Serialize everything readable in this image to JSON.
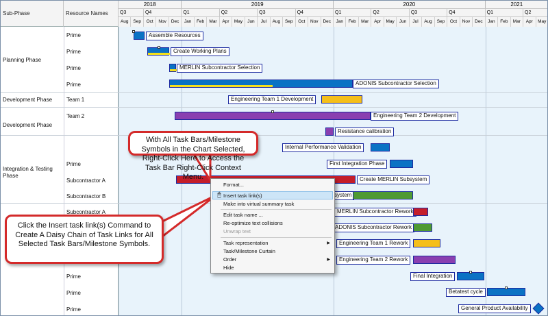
{
  "header": {
    "subphase": "Sub-Phase",
    "resource": "Resource Names",
    "years": [
      "2018",
      "2019",
      "2020",
      "2021"
    ],
    "quarters": [
      "Q3",
      "Q4",
      "Q1",
      "Q2",
      "Q3",
      "Q4",
      "Q1",
      "Q2",
      "Q3",
      "Q4",
      "Q1",
      "Q2"
    ],
    "months": [
      "Aug",
      "Sep",
      "Oct",
      "Nov",
      "Dec",
      "Jan",
      "Feb",
      "Mar",
      "Apr",
      "May",
      "Jun",
      "Jul",
      "Aug",
      "Sep",
      "Oct",
      "Nov",
      "Dec",
      "Jan",
      "Feb",
      "Mar",
      "Apr",
      "May",
      "Jun",
      "Jul",
      "Aug",
      "Sep",
      "Oct",
      "Nov",
      "Dec",
      "Jan",
      "Feb",
      "Mar",
      "Apr",
      "May"
    ]
  },
  "phases": [
    "Planning Phase",
    "Development Phase",
    "Development Phase",
    "Integration & Testing Phase"
  ],
  "resources": [
    "Prime",
    "Prime",
    "Prime",
    "Prime",
    "Team 1",
    "Team 2",
    "Prime",
    "Subcontractor A",
    "Subcontractor B",
    "Subcontractor A",
    "Prime",
    "Prime",
    "Prime",
    "Prime"
  ],
  "tasks": {
    "t1": "Assemble Resources",
    "t2": "Create Working Plans",
    "t3": "MERLIN Subcontractor Selection",
    "t4": "ADONIS Subcontractor Selection",
    "t5": "Engineering Team 1 Development",
    "t6": "Engineering Team 2 Development",
    "t7": "Resistance calibration",
    "t8": "Internal Performance Validation",
    "t9": "First Integration Phase",
    "t10": "Create MERLIN Subsystem",
    "t11": "system",
    "t12": "MERLIN Subcontractor Rework",
    "t13": "ADONIS Subcontractor Rework",
    "t14": "Engineering Team 1 Rework",
    "t15": "Engineering Team 2 Rework",
    "t16": "Final Integration",
    "t17": "Betatest cycle",
    "t18": "General Product Availability"
  },
  "callouts": {
    "top": "With All Task Bars/Milestone Symbols in the Chart Selected, Right-Click Here to Access the Task Bar Right-Click Context Menu.",
    "bottom": "Click the Insert task link(s) Command to Create A Daisy Chain of Task Links for All Selected Task Bars/Milestone Symbols."
  },
  "context_menu": {
    "items": [
      {
        "label": "Format...",
        "enabled": true
      },
      {
        "label": "Insert task link(s)",
        "enabled": true,
        "highlighted": true
      },
      {
        "label": "Make into virtual summary task",
        "enabled": true
      },
      {
        "label": "Edit task name ...",
        "enabled": true
      },
      {
        "label": "Re-optimize text collisions",
        "enabled": true
      },
      {
        "label": "Unwrap text",
        "enabled": false
      },
      {
        "label": "Task representation",
        "enabled": true,
        "submenu": true
      },
      {
        "label": "Task/Milestone Curtain",
        "enabled": true
      },
      {
        "label": "Order",
        "enabled": true,
        "submenu": true
      },
      {
        "label": "Hide",
        "enabled": true
      }
    ]
  },
  "colors": {
    "bar_blue": "#0a72c4",
    "bar_gold": "#f5bf1a",
    "bar_purple": "#8a3fb0",
    "bar_red": "#c41e2a",
    "bar_green": "#4f9a33",
    "outline": "#1c2aa0",
    "callout_border": "#d42a2a"
  },
  "icons": {
    "submenu": "triangle-right-icon",
    "cursor": "mouse-pointer-icon"
  }
}
